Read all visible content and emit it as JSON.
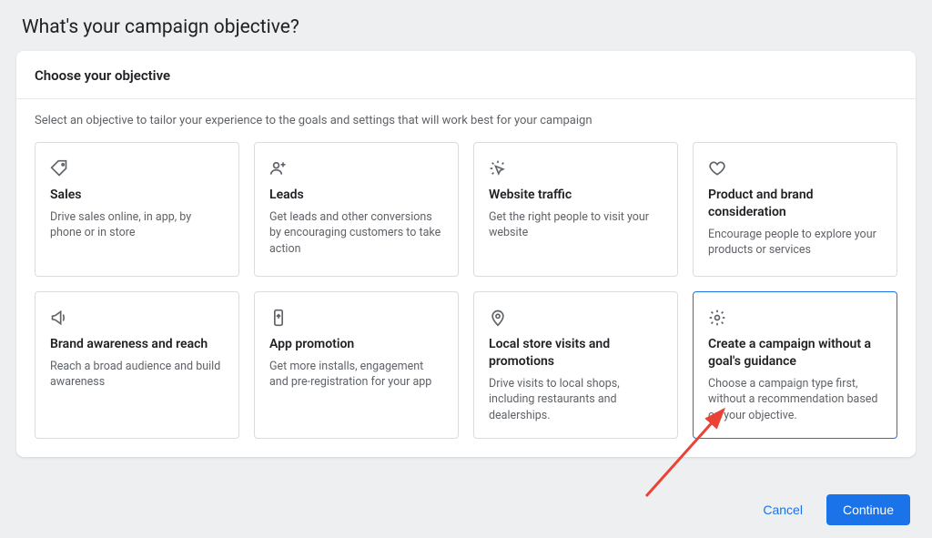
{
  "pageTitle": "What's your campaign objective?",
  "cardHeader": "Choose your objective",
  "cardSub": "Select an objective to tailor your experience to the goals and settings that will work best for your campaign",
  "objectives": [
    {
      "icon": "tag-icon",
      "title": "Sales",
      "desc": "Drive sales online, in app, by phone or in store"
    },
    {
      "icon": "leads-icon",
      "title": "Leads",
      "desc": "Get leads and other conversions by encouraging customers to take action"
    },
    {
      "icon": "click-icon",
      "title": "Website traffic",
      "desc": "Get the right people to visit your website"
    },
    {
      "icon": "heart-icon",
      "title": "Product and brand consideration",
      "desc": "Encourage people to explore your products or services"
    },
    {
      "icon": "megaphone-icon",
      "title": "Brand awareness and reach",
      "desc": "Reach a broad audience and build awareness"
    },
    {
      "icon": "phone-icon",
      "title": "App promotion",
      "desc": "Get more installs, engagement and pre-registration for your app"
    },
    {
      "icon": "pin-icon",
      "title": "Local store visits and promotions",
      "desc": "Drive visits to local shops, including restaurants and dealerships."
    },
    {
      "icon": "gear-icon",
      "title": "Create a campaign without a goal's guidance",
      "desc": "Choose a campaign type first, without a recommendation based on your objective."
    }
  ],
  "selectedIndex": 7,
  "buttons": {
    "cancel": "Cancel",
    "continue": "Continue"
  }
}
